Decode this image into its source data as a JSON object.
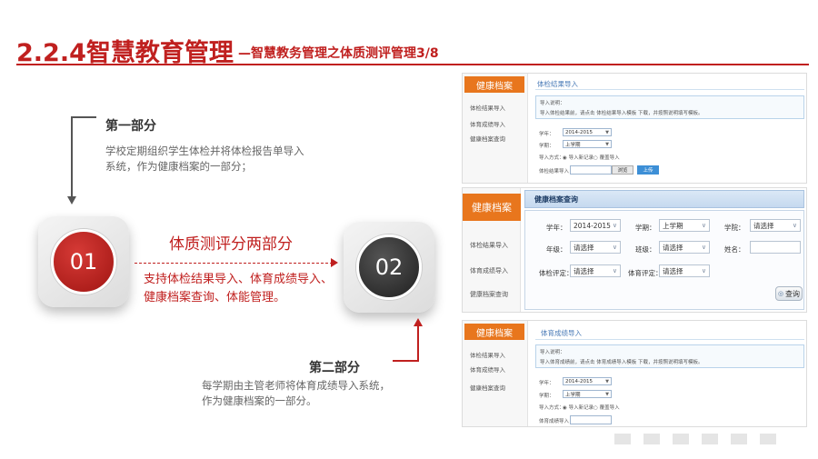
{
  "header": {
    "title": "2.2.4智慧教育管理",
    "subtitle": "—智慧教务管理之体质测评管理3/8"
  },
  "diagram": {
    "part1_label": "第一部分",
    "part1_text": "学校定期组织学生体检并将体检报告单导入系统，作为健康档案的一部分；",
    "circle1": "01",
    "circle2": "02",
    "center_title": "体质测评分两部分",
    "center_text": "支持体检结果导入、体育成绩导入、健康档案查询、体能管理。",
    "part2_label": "第二部分",
    "part2_text": "每学期由主管老师将体育成绩导入系统，作为健康档案的一部分。"
  },
  "panel1": {
    "side_title": "健康档案",
    "side_items": [
      "体检结果导入",
      "体育成绩导入",
      "健康档案查询"
    ],
    "content_title": "体检结果导入",
    "note_label": "导入说明：",
    "note_text": "导入体检结果前，请点击 体检结果导入模板 下载，并按照说明填写模板。",
    "year_label": "学年：",
    "year_value": "2014-2015",
    "term_label": "学期：",
    "term_value": "上学期",
    "mode_label": "导入方式：",
    "mode_opt1": "导入新记录",
    "mode_opt2": "覆盖导入",
    "file_label": "体检结果导入：",
    "browse_btn": "浏览",
    "upload_btn": "上传"
  },
  "panel2": {
    "side_title": "健康档案",
    "side_items": [
      "体检结果导入",
      "体育成绩导入",
      "健康档案查询"
    ],
    "content_title": "健康档案查询",
    "fields": {
      "year_label": "学年：",
      "year_value": "2014-2015",
      "term_label": "学期：",
      "term_value": "上学期",
      "school_label": "学院：",
      "school_value": "请选择",
      "grade_label": "年级：",
      "grade_value": "请选择",
      "class_label": "班级：",
      "class_value": "请选择",
      "name_label": "姓名：",
      "name_value": "",
      "health_label": "体检评定：",
      "health_value": "请选择",
      "sport_label": "体育评定：",
      "sport_value": "请选择"
    },
    "query_btn": "查询"
  },
  "panel3": {
    "side_title": "健康档案",
    "side_items": [
      "体检结果导入",
      "体育成绩导入",
      "健康档案查询"
    ],
    "content_title": "体育成绩导入",
    "note_label": "导入说明：",
    "note_text": "导入体育成绩前，请点击 体育成绩导入模板 下载，并按照说明填写模板。",
    "year_label": "学年：",
    "year_value": "2014-2015",
    "term_label": "学期：",
    "term_value": "上学期",
    "mode_label": "导入方式：",
    "mode_opt1": "导入新记录",
    "mode_opt2": "覆盖导入",
    "file_label": "体育成绩导入："
  },
  "colors": {
    "accent": "#c0201f",
    "orange": "#e8761d",
    "blue": "#3d8fd6"
  }
}
